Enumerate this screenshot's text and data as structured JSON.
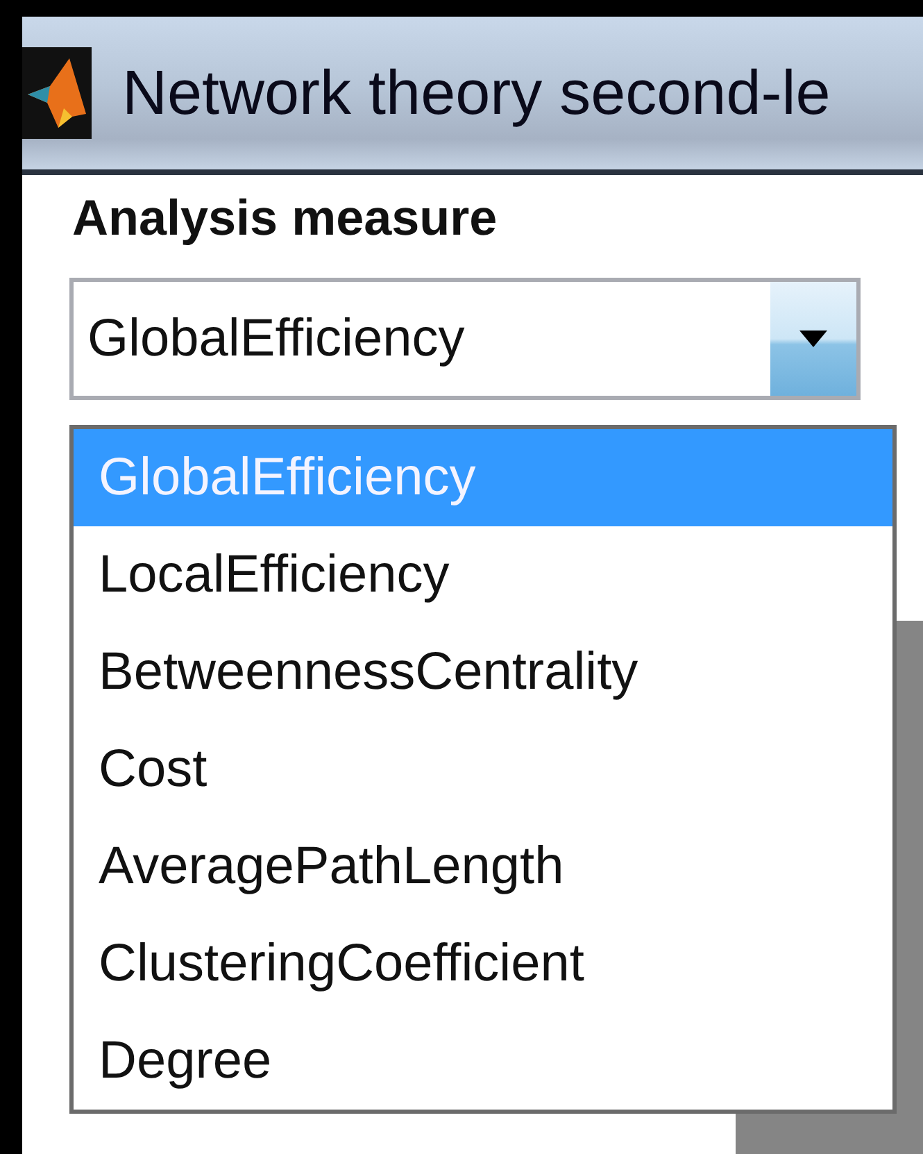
{
  "window": {
    "title": "Network theory second-le"
  },
  "measure_label": "Analysis measure",
  "combo": {
    "value": "GlobalEfficiency",
    "expanded": true
  },
  "dropdown": [
    {
      "label": "GlobalEfficiency",
      "selected": true
    },
    {
      "label": "LocalEfficiency",
      "selected": false
    },
    {
      "label": "BetweennessCentrality",
      "selected": false
    },
    {
      "label": "Cost",
      "selected": false
    },
    {
      "label": "AveragePathLength",
      "selected": false
    },
    {
      "label": "ClusteringCoefficient",
      "selected": false
    },
    {
      "label": "Degree",
      "selected": false
    }
  ]
}
